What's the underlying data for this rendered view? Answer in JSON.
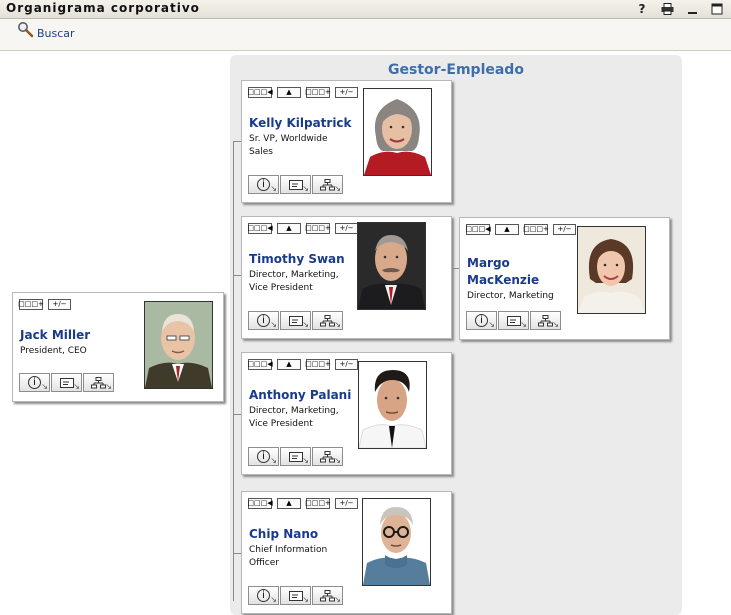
{
  "window": {
    "title": "Organigrama corporativo",
    "icons": [
      "help-icon",
      "print-icon",
      "minimize-icon",
      "maximize-icon"
    ]
  },
  "toolbar": {
    "search_label": "Buscar"
  },
  "panel": {
    "title": "Gestor-Empleado"
  },
  "card_buttons": {
    "show_reports": "□□□◀",
    "go_up": "▲",
    "show_chain": "□□□+",
    "toggle": "+/−"
  },
  "people": {
    "root": {
      "name": "Jack Miller",
      "title_lines": [
        "President, CEO"
      ]
    },
    "kelly": {
      "name": "Kelly Kilpatrick",
      "title_lines": [
        "Sr. VP, Worldwide",
        "Sales"
      ]
    },
    "timothy": {
      "name": "Timothy Swan",
      "title_lines": [
        "Director, Marketing,",
        "Vice President"
      ]
    },
    "margo": {
      "name_lines": [
        "Margo",
        "MacKenzie"
      ],
      "title_lines": [
        "Director, Marketing"
      ]
    },
    "anthony": {
      "name": "Anthony Palani",
      "title_lines": [
        "Director, Marketing,",
        "Vice President"
      ]
    },
    "chip": {
      "name": "Chip Nano",
      "title_lines": [
        "Chief Information",
        "Officer"
      ]
    }
  },
  "colors": {
    "name_link": "#1a3a8c",
    "panel_title": "#3e6ea8",
    "panel_bg": "#ebebeb"
  }
}
